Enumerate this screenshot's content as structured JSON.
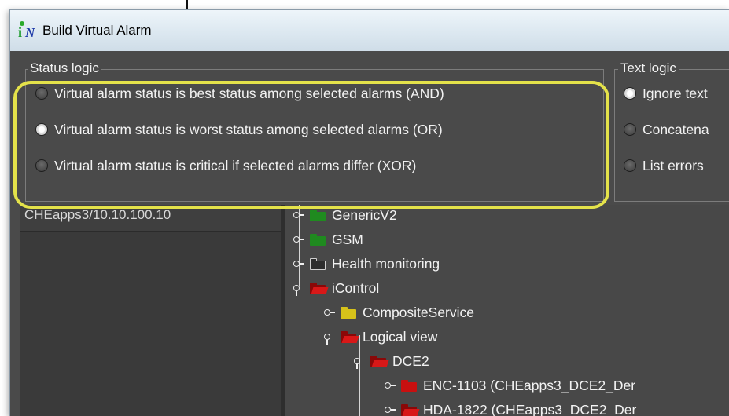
{
  "window": {
    "title": "Build Virtual Alarm",
    "app_icon": "iN-logo-icon"
  },
  "status_logic": {
    "legend": "Status logic",
    "options": [
      {
        "label": "Virtual alarm status is best status among selected alarms (AND)",
        "checked": false
      },
      {
        "label": "Virtual alarm status is worst status among selected alarms (OR)",
        "checked": true
      },
      {
        "label": "Virtual alarm status is critical if selected alarms differ (XOR)",
        "checked": false
      }
    ]
  },
  "text_logic": {
    "legend": "Text logic",
    "options": [
      {
        "label": "Ignore text",
        "checked": true
      },
      {
        "label": "Concatena",
        "checked": false
      },
      {
        "label": "List errors",
        "checked": false
      }
    ]
  },
  "left_pane": {
    "path": "CHEapps3/10.10.100.10"
  },
  "tree": [
    {
      "label": "GenericV2",
      "color": "#1f8a1f",
      "open": false
    },
    {
      "label": "GSM",
      "color": "#1f8a1f",
      "open": false
    },
    {
      "label": "Health monitoring",
      "color": "#3a3a3a",
      "open": false
    },
    {
      "label": "iControl",
      "color": "#c81010",
      "open": true
    },
    {
      "label": "CompositeService",
      "color": "#d6c21a",
      "open": false
    },
    {
      "label": "Logical view",
      "color": "#c81010",
      "open": true
    },
    {
      "label": "DCE2",
      "color": "#c81010",
      "open": true
    },
    {
      "label": "ENC-1103 (CHEapps3_DCE2_Der",
      "color": "#c81010",
      "open": false
    },
    {
      "label": "HDA-1822 (CHEapps3_DCE2_Der",
      "color": "#c81010",
      "open": false
    }
  ],
  "highlight_color": "#e4e24a"
}
